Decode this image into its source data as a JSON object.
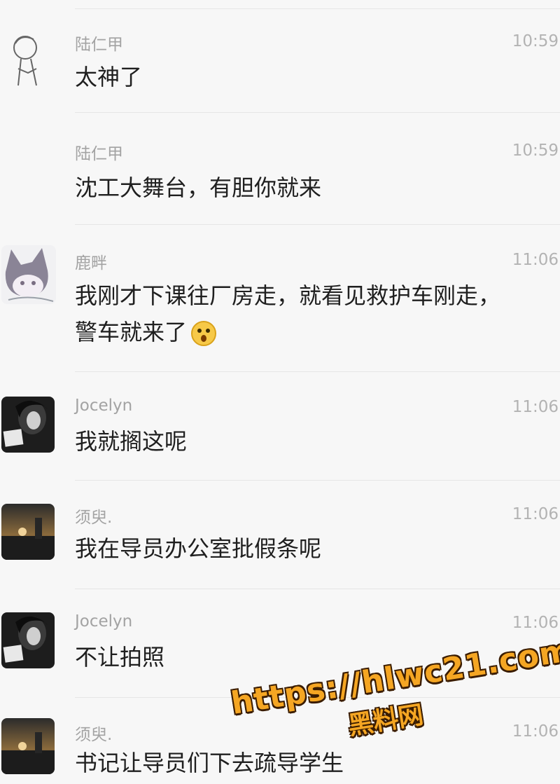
{
  "messages": [
    {
      "sender": "陆仁甲",
      "time": "10:59",
      "text": "太神了",
      "avatar": "line-drawing-boy-avatar"
    },
    {
      "sender": "陆仁甲",
      "time": "10:59",
      "text": "沈工大舞台，有胆你就来",
      "avatar": ""
    },
    {
      "sender": "鹿畔",
      "time": "11:06",
      "text": "我刚才下课往厂房走，就看见救护车刚走，",
      "text2": "警车就来了",
      "emoji": "surprised-emoji",
      "avatar": "cat-ear-anime-avatar"
    },
    {
      "sender": "Jocelyn",
      "time": "11:06",
      "text": "我就搁这呢",
      "avatar": "dark-photo-person-avatar"
    },
    {
      "sender": "须臾.",
      "time": "11:06",
      "text": "我在导员办公室批假条呢",
      "avatar": "sunset-photo-avatar"
    },
    {
      "sender": "Jocelyn",
      "time": "11:06",
      "text": "不让拍照",
      "avatar": "dark-photo-person-avatar"
    },
    {
      "sender": "须臾.",
      "time": "11:06",
      "text": "书记让导员们下去疏导学生",
      "avatar": "sunset-photo-avatar"
    }
  ],
  "watermark": {
    "line1": "https://hlwc21.com",
    "line2": "黑料网"
  },
  "colors": {
    "background": "#f7f7f7",
    "name": "#a3a3a3",
    "time": "#b3b3b3",
    "text": "#1f1f1f",
    "watermark": "#f5a623"
  }
}
